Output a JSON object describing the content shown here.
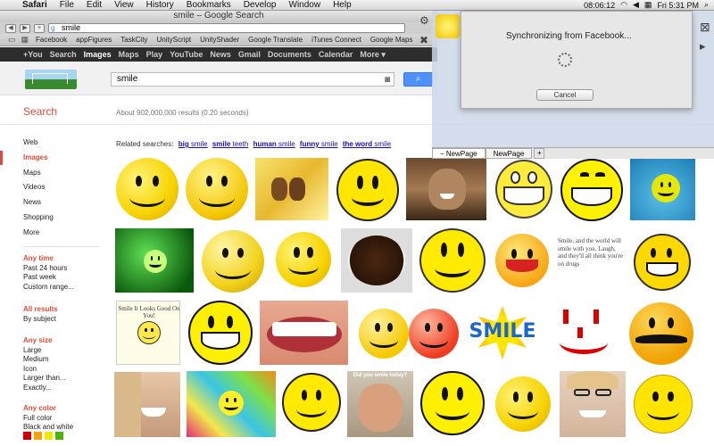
{
  "menubar": {
    "app": "Safari",
    "items": [
      "File",
      "Edit",
      "View",
      "History",
      "Bookmarks",
      "Develop",
      "Window",
      "Help"
    ],
    "clock": "08:06:12",
    "day_time": "Fri 5:31 PM"
  },
  "window": {
    "title": "smile – Google Search"
  },
  "toolbar": {
    "url": "smile"
  },
  "bookmarks": [
    "Facebook",
    "appFigures",
    "TaskCity",
    "UnityScript",
    "UnityShader",
    "Google Translate",
    "iTunes Connect",
    "Google Maps"
  ],
  "gbar": [
    "+You",
    "Search",
    "Images",
    "Maps",
    "Play",
    "YouTube",
    "News",
    "Gmail",
    "Documents",
    "Calendar",
    "More ▾"
  ],
  "search": {
    "query": "smile",
    "results": "About 902,000,000 results (0.20 seconds)",
    "label": "Search"
  },
  "leftnav": [
    "Web",
    "Images",
    "Maps",
    "Videos",
    "News",
    "Shopping",
    "More"
  ],
  "filters": {
    "time": {
      "head": "Any time",
      "items": [
        "Past 24 hours",
        "Past week",
        "Custom range..."
      ]
    },
    "results": {
      "head": "All results",
      "items": [
        "By subject"
      ]
    },
    "size": {
      "head": "Any size",
      "items": [
        "Large",
        "Medium",
        "Icon",
        "Larger than...",
        "Exactly..."
      ]
    },
    "color": {
      "head": "Any color",
      "items": [
        "Full color",
        "Black and white"
      ]
    }
  },
  "swatch_colors": [
    "#cc0000",
    "#f4a300",
    "#f4e800",
    "#49b500"
  ],
  "related": {
    "prefix": "Related searches:",
    "links": [
      {
        "bold": "big",
        "norm": " smile"
      },
      {
        "bold": "smile",
        "norm": " teeth"
      },
      {
        "bold": "human",
        "norm": " smile"
      },
      {
        "bold": "funny",
        "norm": " smile"
      },
      {
        "bold": "the word",
        "norm": " smile"
      }
    ]
  },
  "sync": {
    "message": "Synchronizing from Facebook...",
    "cancel": "Cancel"
  },
  "tabs": [
    "NewPage",
    "NewPage"
  ],
  "image_texts": {
    "smile_it_looks": "Smile It Looks Good On You!",
    "smile_word": "SMILE",
    "smile_quote": "Smile, and the world will smile with you. Laugh, and they'll all think you're on drugs"
  },
  "colors": {
    "google_red": "#dd4b39",
    "google_blue": "#4d90fe",
    "smiley_yellow": "#f7d300"
  }
}
